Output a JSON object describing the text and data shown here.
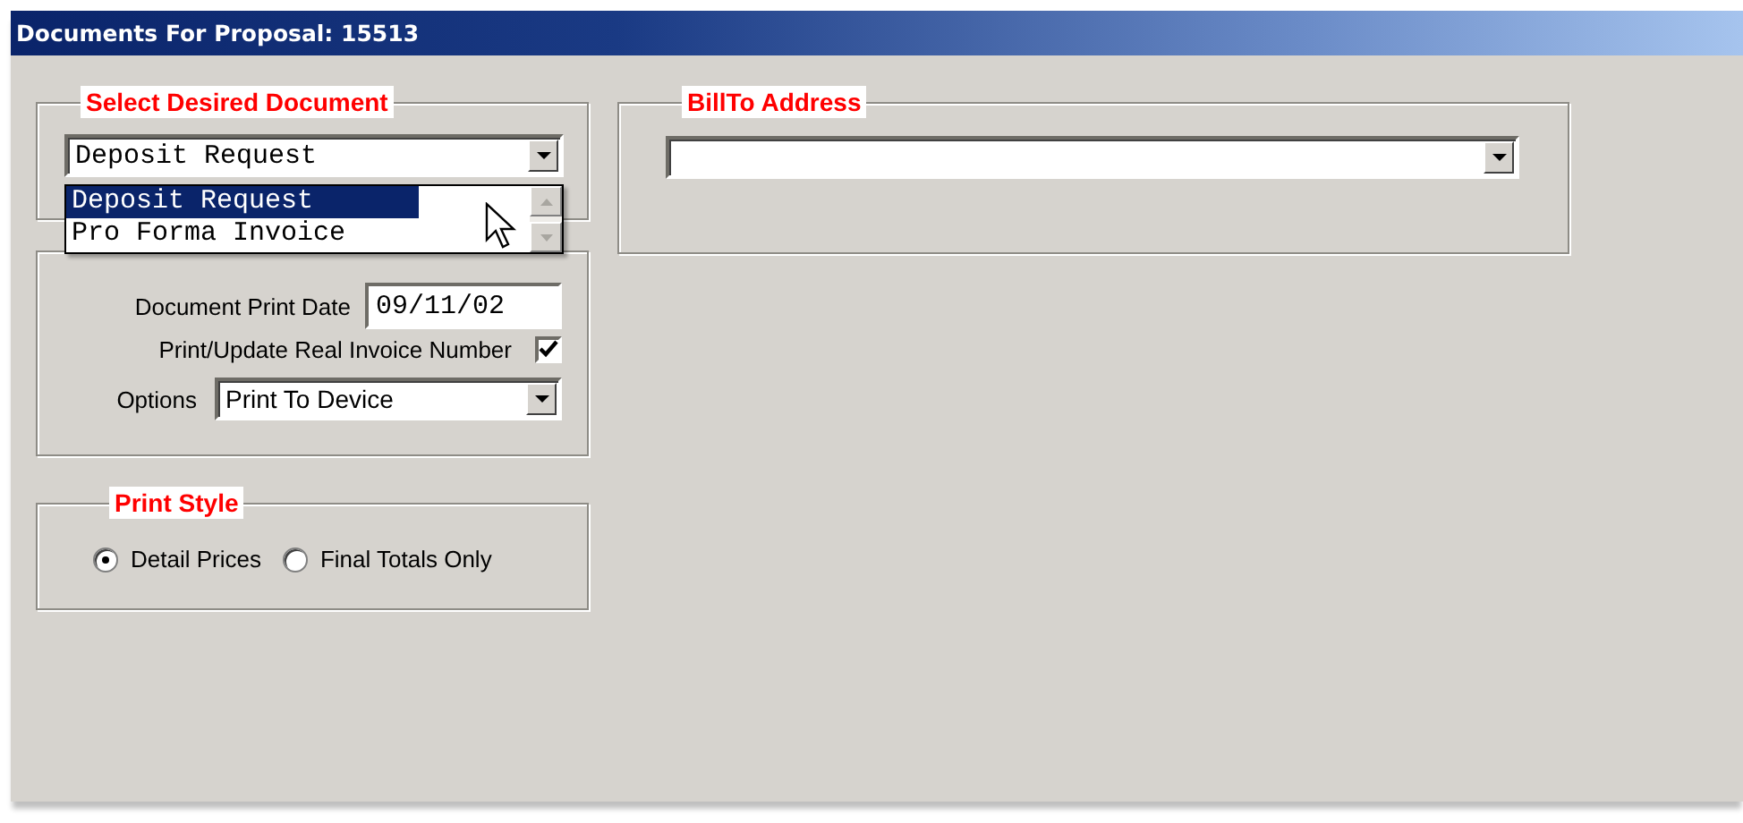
{
  "window": {
    "title": "Documents For Proposal: 15513"
  },
  "document_group": {
    "legend": "Select Desired Document",
    "combo": {
      "value": "Deposit Request"
    },
    "dropdown": {
      "options": [
        {
          "label": "Deposit Request",
          "selected": true
        },
        {
          "label": "Pro Forma Invoice",
          "selected": false
        }
      ]
    }
  },
  "print_parameters": {
    "fields": [
      {
        "kind": "text",
        "label": "Document Print Date",
        "value": "09/11/02"
      },
      {
        "kind": "checkbox",
        "label": "Print/Update Real Invoice Number",
        "checked": true
      },
      {
        "kind": "select",
        "label": "Options",
        "value": "Print To Device"
      }
    ]
  },
  "print_style": {
    "legend": "Print Style",
    "options": [
      {
        "label": "Detail Prices",
        "selected": true
      },
      {
        "label": "Final Totals Only",
        "selected": false
      }
    ]
  },
  "billto": {
    "legend": "BillTo Address"
  }
}
